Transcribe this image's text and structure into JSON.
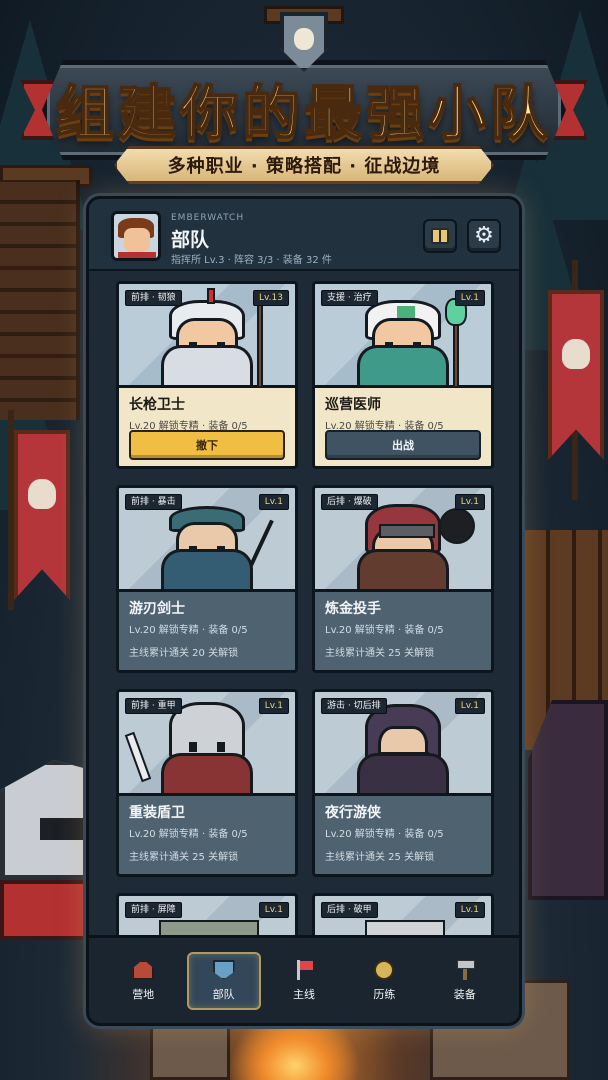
{
  "banner": {
    "title": "组建你的最强小队",
    "subtitle": "多种职业 · 策略搭配 · 征战边境"
  },
  "panel": {
    "brand": "EMBERWATCH",
    "title": "部队",
    "subtitle": "指挥所 Lv.3 · 阵容 3/3 · 装备 32 件",
    "icons": {
      "codex": "book-icon",
      "settings": "gear-icon"
    }
  },
  "units": [
    {
      "tag": "前排 · 韧狼",
      "level": "Lv.13",
      "name": "长枪卫士",
      "stats": "Lv.20 解锁专精 · 装备 0/5",
      "action": "撤下",
      "locked": false
    },
    {
      "tag": "支援 · 治疗",
      "level": "Lv.1",
      "name": "巡营医师",
      "stats": "Lv.20 解锁专精 · 装备 0/5",
      "action": "出战",
      "locked": false
    },
    {
      "tag": "前排 · 暴击",
      "level": "Lv.1",
      "name": "游刃剑士",
      "stats": "Lv.20 解锁专精 · 装备 0/5",
      "unlock": "主线累计通关 20 关解锁",
      "locked": true
    },
    {
      "tag": "后排 · 爆破",
      "level": "Lv.1",
      "name": "炼金投手",
      "stats": "Lv.20 解锁专精 · 装备 0/5",
      "unlock": "主线累计通关 25 关解锁",
      "locked": true
    },
    {
      "tag": "前排 · 重甲",
      "level": "Lv.1",
      "name": "重装盾卫",
      "stats": "Lv.20 解锁专精 · 装备 0/5",
      "unlock": "主线累计通关 25 关解锁",
      "locked": true
    },
    {
      "tag": "游击 · 切后排",
      "level": "Lv.1",
      "name": "夜行游侠",
      "stats": "Lv.20 解锁专精 · 装备 0/5",
      "unlock": "主线累计通关 25 关解锁",
      "locked": true
    },
    {
      "tag": "前排 · 屏障",
      "level": "Lv.1",
      "locked": true
    },
    {
      "tag": "后排 · 破甲",
      "level": "Lv.1",
      "locked": true
    }
  ],
  "nav": [
    {
      "label": "营地",
      "icon": "camp-icon",
      "active": false
    },
    {
      "label": "部队",
      "icon": "shield-icon",
      "active": true
    },
    {
      "label": "主线",
      "icon": "flag-icon",
      "active": false
    },
    {
      "label": "历练",
      "icon": "compass-icon",
      "active": false
    },
    {
      "label": "装备",
      "icon": "hammer-icon",
      "active": false
    }
  ],
  "colors": {
    "accent_gold": "#f0be43",
    "panel_bg": "#1e2b37",
    "card_cream": "#f2e6c9",
    "locked_slate": "#4e6270"
  }
}
